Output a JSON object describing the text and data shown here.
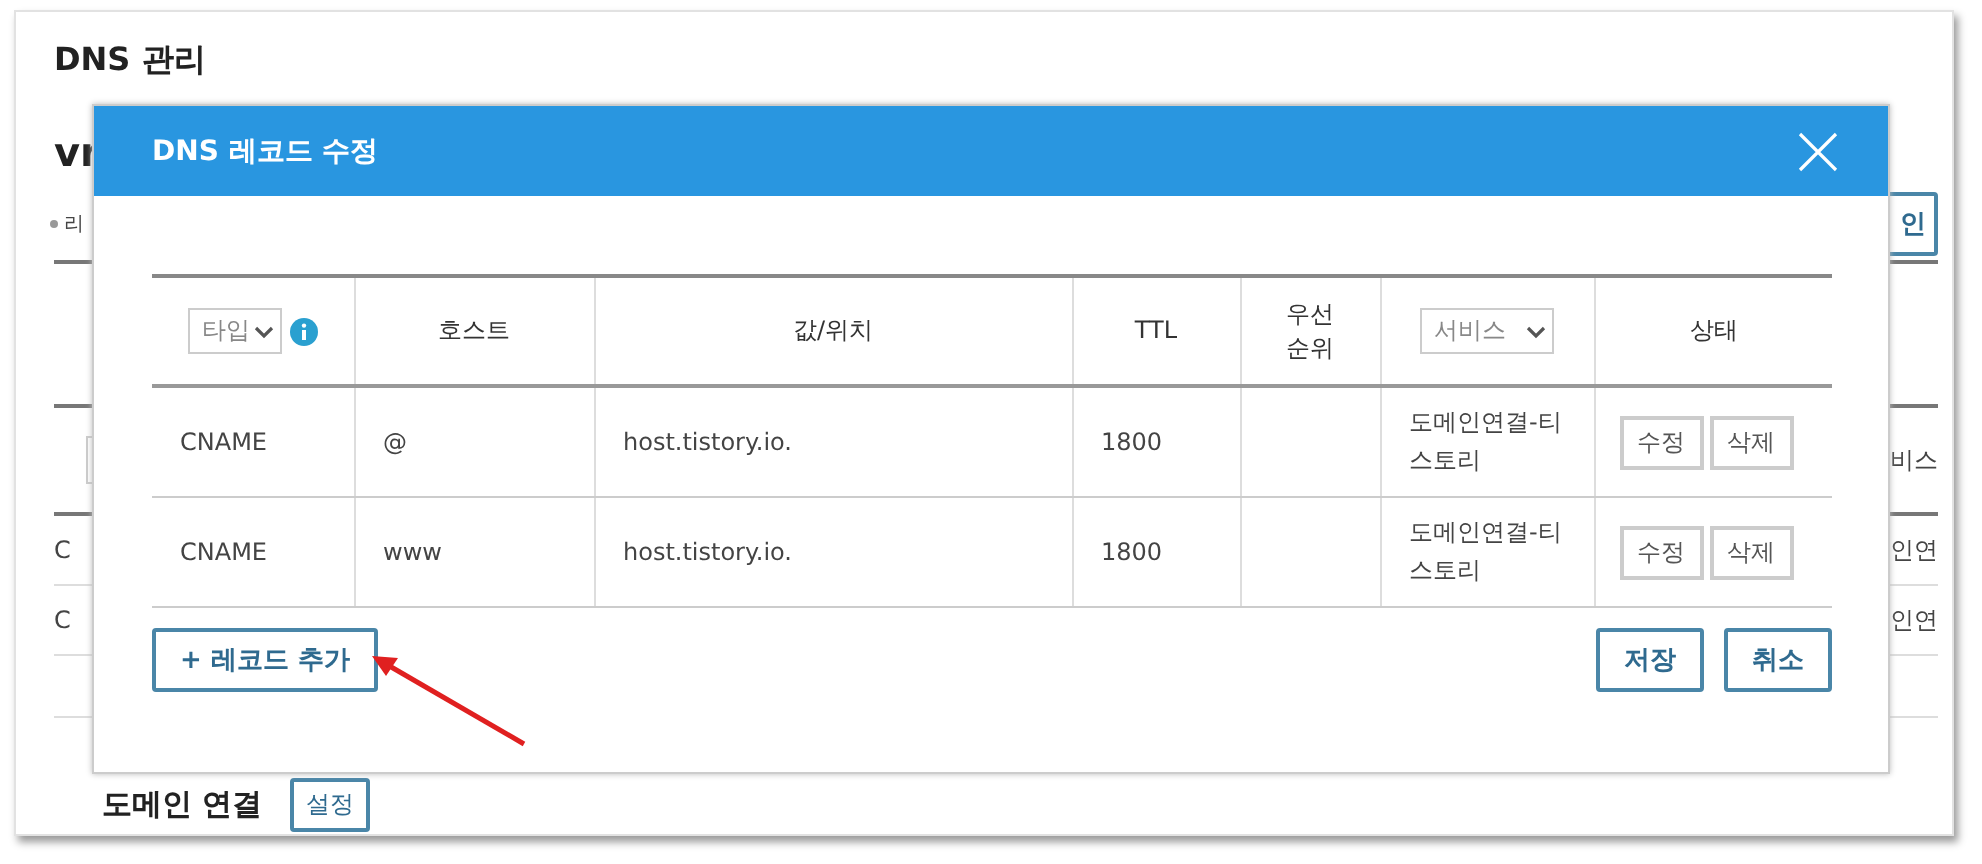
{
  "page": {
    "title": "DNS 관리",
    "heading_fragment": "vr",
    "bullet_fragment": "리",
    "button_fragment": "인",
    "table_fragments": {
      "header": "비스",
      "rows": [
        {
          "column_1": "C",
          "column_2": "인연"
        },
        {
          "column_1": "C",
          "column_2": "인연"
        }
      ]
    },
    "domain_connect": {
      "label": "도메인 연결",
      "button": "설정"
    }
  },
  "dialog": {
    "title": "DNS 레코드 수정",
    "columns": [
      {
        "kind": "select-info",
        "label": "타입"
      },
      {
        "kind": "text",
        "label": "호스트"
      },
      {
        "kind": "text",
        "label": "값/위치"
      },
      {
        "kind": "text",
        "label": "TTL"
      },
      {
        "kind": "text",
        "label": "우선\n순위"
      },
      {
        "kind": "select",
        "label": "서비스"
      },
      {
        "kind": "text",
        "label": "상태"
      }
    ],
    "rows": [
      {
        "type": "CNAME",
        "host": "@",
        "value": "host.tistory.io.",
        "ttl": "1800",
        "service": "도메인연결-티\n스토리",
        "actions": [
          "수정",
          "삭제"
        ]
      },
      {
        "type": "CNAME",
        "host": "www",
        "value": "host.tistory.io.",
        "ttl": "1800",
        "service": "도메인연결-티\n스토리",
        "actions": [
          "수정",
          "삭제"
        ]
      }
    ],
    "add_button": "+ 레코드 추가",
    "buttons": [
      "저장",
      "취소"
    ]
  }
}
